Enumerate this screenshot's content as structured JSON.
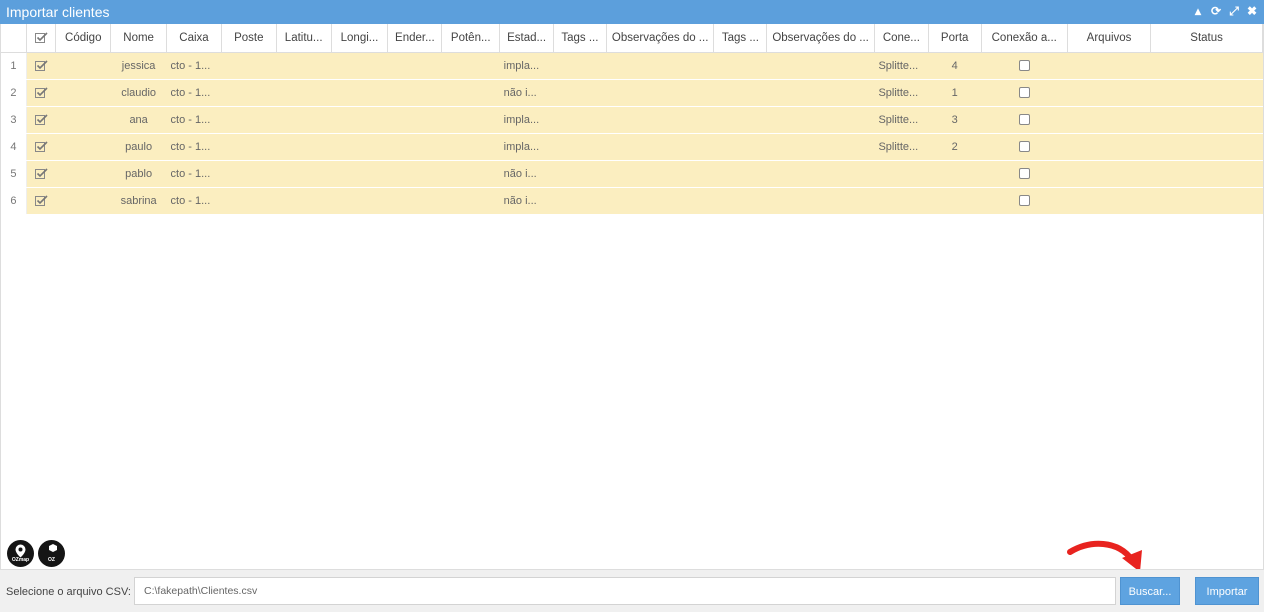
{
  "window": {
    "title": "Importar clientes",
    "tools": [
      "minimize-icon",
      "refresh-icon",
      "expand-icon",
      "close-icon"
    ]
  },
  "table": {
    "columns": [
      "",
      "",
      "Código",
      "Nome",
      "Caixa",
      "Poste",
      "Latitu...",
      "Longi...",
      "Ender...",
      "Potên...",
      "Estad...",
      "Tags ...",
      "Observações do ...",
      "Tags ...",
      "Observações do ...",
      "Cone...",
      "Porta",
      "Conexão a...",
      "Arquivos",
      "Status"
    ],
    "rows": [
      {
        "num": "1",
        "nome": "jessica",
        "caixa": "cto - 1...",
        "estado": "impla...",
        "conexao": "Splitte...",
        "porta": "4"
      },
      {
        "num": "2",
        "nome": "claudio",
        "caixa": "cto - 1...",
        "estado": "não i...",
        "conexao": "Splitte...",
        "porta": "1"
      },
      {
        "num": "3",
        "nome": "ana",
        "caixa": "cto - 1...",
        "estado": "impla...",
        "conexao": "Splitte...",
        "porta": "3"
      },
      {
        "num": "4",
        "nome": "paulo",
        "caixa": "cto - 1...",
        "estado": "impla...",
        "conexao": "Splitte...",
        "porta": "2"
      },
      {
        "num": "5",
        "nome": "pablo",
        "caixa": "cto - 1...",
        "estado": "não i...",
        "conexao": "",
        "porta": ""
      },
      {
        "num": "6",
        "nome": "sabrina",
        "caixa": "cto - 1...",
        "estado": "não i...",
        "conexao": "",
        "porta": ""
      }
    ]
  },
  "logos": [
    {
      "name": "ozmap-logo",
      "caption": "OZmap"
    },
    {
      "name": "oz-logo",
      "caption": "OZ"
    }
  ],
  "footer": {
    "label": "Selecione o arquivo CSV:",
    "file_value": "C:\\fakepath\\Clientes.csv",
    "search_label": "Buscar...",
    "import_label": "Importar"
  },
  "colors": {
    "titlebar": "#5c9fdc",
    "row_bg": "#fbeec0",
    "button": "#5ea3e0",
    "annotation_arrow": "#e8231f"
  }
}
